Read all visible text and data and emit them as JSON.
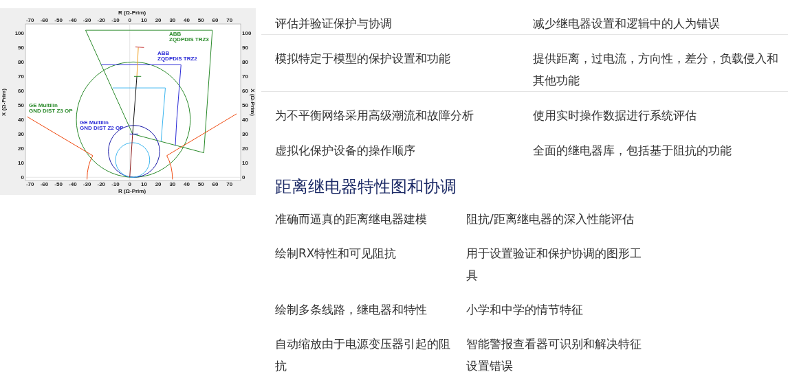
{
  "diagram": {
    "top_title": "R (Ω-Prim)",
    "bottom_title": "R (Ω-Prim)",
    "left_title": "X (Ω-Prim)",
    "right_title": "X (Ω-Prim)",
    "top_ticks": [
      "-70",
      "-60",
      "-50",
      "-40",
      "-30",
      "-20",
      "-10",
      "0",
      "10",
      "20",
      "30",
      "40",
      "50",
      "60",
      "70"
    ],
    "bottom_ticks": [
      "-70",
      "-60",
      "-50",
      "-40",
      "-30",
      "-20",
      "-10",
      "0",
      "10",
      "20",
      "30",
      "40",
      "50",
      "60",
      "70"
    ],
    "left_ticks": [
      "100",
      "90",
      "80",
      "70",
      "60",
      "50",
      "40",
      "30",
      "20",
      "10",
      "0"
    ],
    "right_ticks": [
      "100",
      "90",
      "80",
      "70",
      "60",
      "50",
      "40",
      "30",
      "20",
      "10",
      "0"
    ],
    "labels": [
      {
        "lines": [
          "ABB",
          "ZQDPDIS TRZ3"
        ],
        "color": "#2a8a2a"
      },
      {
        "lines": [
          "ABB",
          "ZQDPDIS TRZ2"
        ],
        "color": "#2b2bd6"
      },
      {
        "lines": [
          "GE Multilin",
          "GND DIST Z3 OP"
        ],
        "color": "#2a8a2a"
      },
      {
        "lines": [
          "GE Multilin",
          "GND DIST Z2 OP"
        ],
        "color": "#2b2bd6"
      }
    ]
  },
  "features": [
    {
      "left": "评估并验证保护与协调",
      "right": "减少继电器设置和逻辑中的人为错误"
    },
    {
      "left": "模拟特定于模型的保护设置和功能",
      "right": "提供距离，过电流，方向性，差分，负载侵入和其他功能"
    },
    {
      "left": "为不平衡网络采用高级潮流和故障分析",
      "right": "使用实时操作数据进行系统评估"
    },
    {
      "left": "虚拟化保护设备的操作顺序",
      "right": "全面的继电器库，包括基于阻抗的功能"
    }
  ],
  "section": {
    "heading": "距离继电器特性图和协调",
    "rows": [
      {
        "left": "准确而逼真的距离继电器建模",
        "right": "阻抗/距离继电器的深入性能评估"
      },
      {
        "left": "绘制RX特性和可见阻抗",
        "right": "用于设置验证和保护协调的图形工具"
      },
      {
        "left": "绘制多条线路，继电器和特性",
        "right": "小学和中学的情节特征"
      },
      {
        "left": "自动缩放由于电源变压器引起的阻抗",
        "right": "智能警报查看器可识别和解决特征设置错误"
      }
    ]
  }
}
